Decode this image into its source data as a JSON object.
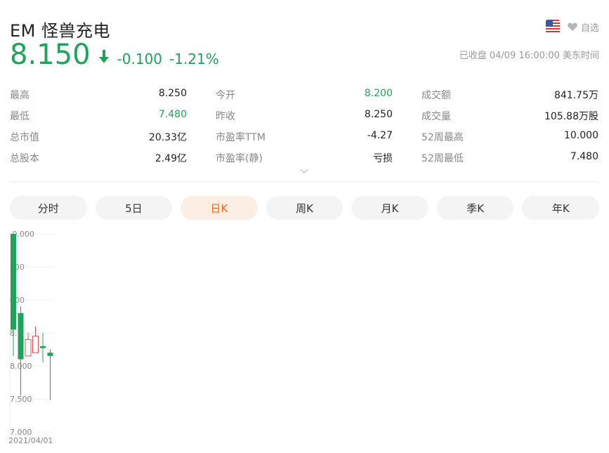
{
  "header": {
    "title": "EM 怪兽充电",
    "watch_label": "自选",
    "price": "8.150",
    "change": "-0.100",
    "change_pct": "-1.21%",
    "market_status": "已收盘 04/09 16:00:00 美东时间"
  },
  "stats": [
    [
      {
        "label": "最高",
        "value": "8.250",
        "color": "normal"
      },
      {
        "label": "今开",
        "value": "8.200",
        "color": "green"
      },
      {
        "label": "成交额",
        "value": "841.75万",
        "color": "normal"
      }
    ],
    [
      {
        "label": "最低",
        "value": "7.480",
        "color": "green"
      },
      {
        "label": "昨收",
        "value": "8.250",
        "color": "normal"
      },
      {
        "label": "成交量",
        "value": "105.88万股",
        "color": "normal"
      }
    ],
    [
      {
        "label": "总市值",
        "value": "20.33亿",
        "color": "normal"
      },
      {
        "label": "市盈率TTM",
        "value": "-4.27",
        "color": "normal"
      },
      {
        "label": "52周最高",
        "value": "10.000",
        "color": "normal"
      }
    ],
    [
      {
        "label": "总股本",
        "value": "2.49亿",
        "color": "normal"
      },
      {
        "label": "市盈率(静)",
        "value": "亏损",
        "color": "normal"
      },
      {
        "label": "52周最低",
        "value": "7.480",
        "color": "normal"
      }
    ]
  ],
  "tabs": [
    {
      "label": "分时",
      "active": false
    },
    {
      "label": "5日",
      "active": false
    },
    {
      "label": "日K",
      "active": true
    },
    {
      "label": "周K",
      "active": false
    },
    {
      "label": "月K",
      "active": false
    },
    {
      "label": "季K",
      "active": false
    },
    {
      "label": "年K",
      "active": false
    }
  ],
  "colors": {
    "down": "#1ea35a",
    "up": "#e05050",
    "accent": "#f06a1c"
  },
  "chart_data": {
    "type": "candlestick",
    "y_ticks": [
      ".0.000",
      "500",
      "000",
      "8.",
      "8.000",
      "7.500",
      "7.000"
    ],
    "x_label": "2021/04/01",
    "ylim": [
      7.0,
      10.0
    ],
    "candles": [
      {
        "open": 10.0,
        "close": 8.55,
        "high": 10.0,
        "low": 8.15,
        "dir": "down"
      },
      {
        "open": 8.8,
        "close": 8.1,
        "high": 8.9,
        "low": 7.55,
        "dir": "down"
      },
      {
        "open": 8.15,
        "close": 8.4,
        "high": 8.5,
        "low": 8.15,
        "dir": "up"
      },
      {
        "open": 8.2,
        "close": 8.45,
        "high": 8.6,
        "low": 8.2,
        "dir": "up"
      },
      {
        "open": 8.3,
        "close": 8.27,
        "high": 8.5,
        "low": 8.05,
        "dir": "down"
      },
      {
        "open": 8.2,
        "close": 8.15,
        "high": 8.25,
        "low": 7.48,
        "dir": "down"
      }
    ]
  }
}
